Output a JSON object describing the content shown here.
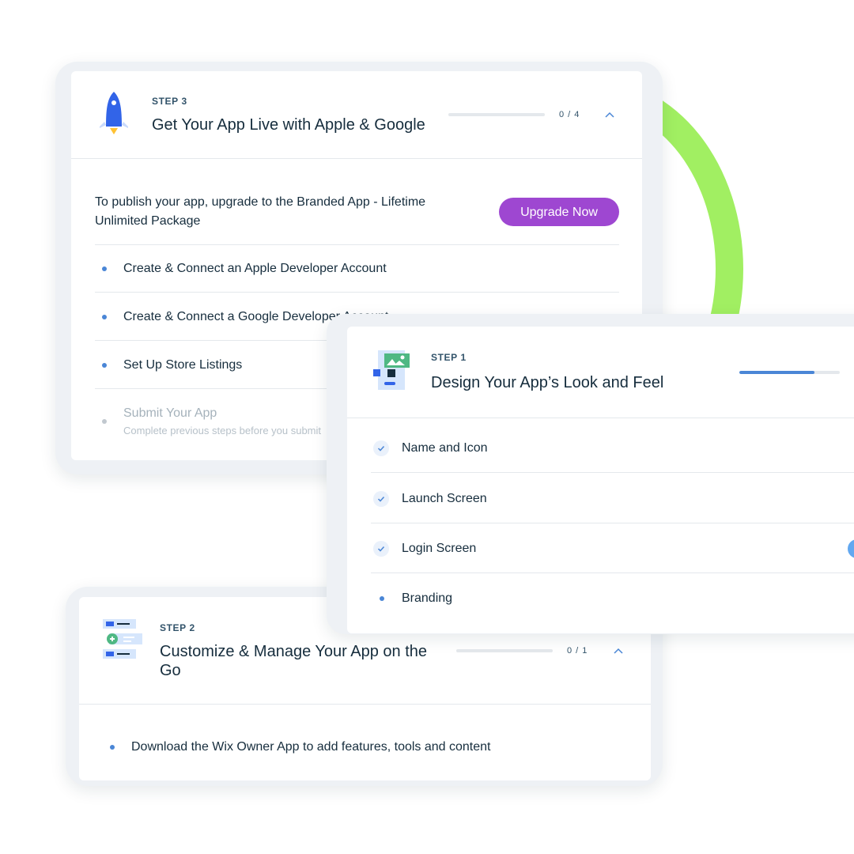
{
  "step3": {
    "step_label": "STEP 3",
    "title": "Get Your App Live with Apple & Google",
    "progress_text": "0 / 4",
    "progress": 0.0,
    "publish_text": "To publish your app, upgrade to the Branded App - Lifetime Unlimited Package",
    "upgrade_label": "Upgrade Now",
    "items": [
      {
        "label": "Create & Connect an Apple Developer Account"
      },
      {
        "label": "Create & Connect a Google Developer Account"
      },
      {
        "label": "Set Up Store Listings"
      },
      {
        "label": "Submit Your App",
        "note": "Complete previous steps before you submit"
      }
    ]
  },
  "step1": {
    "step_label": "STEP 1",
    "title": "Design Your App’s Look and Feel",
    "progress": 0.75,
    "items": [
      {
        "label": "Name and Icon",
        "status": "done"
      },
      {
        "label": "Launch Screen",
        "status": "done"
      },
      {
        "label": "Login Screen",
        "status": "done"
      },
      {
        "label": "Branding",
        "status": "todo"
      }
    ]
  },
  "step2": {
    "step_label": "STEP 2",
    "title": "Customize & Manage Your App on the Go",
    "progress_text": "0 / 1",
    "progress": 0.0,
    "items": [
      {
        "label": "Download the Wix Owner App to add features, tools and content"
      }
    ]
  },
  "colors": {
    "accent_blue": "#4a86d6",
    "upgrade_purple": "#9e47d1",
    "ring_green": "#a1ef62"
  },
  "icons": {
    "step3": "rocket-icon",
    "step1": "design-icon",
    "step2": "manage-list-icon",
    "expand": "chevron-up-icon",
    "done": "check-icon"
  }
}
